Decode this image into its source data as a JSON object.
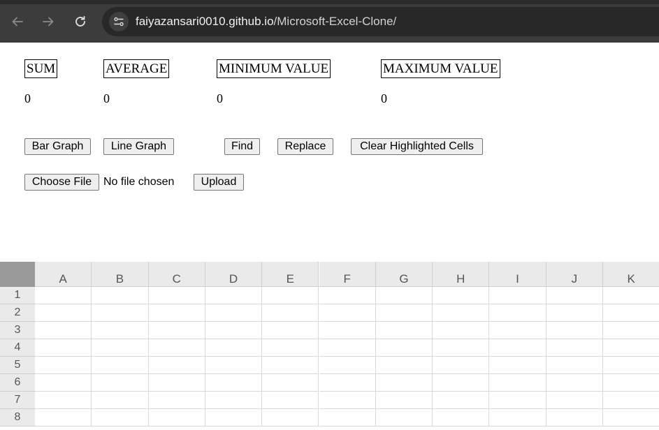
{
  "browser": {
    "url_host": "faiyazansari0010.github.io",
    "url_path": "/Microsoft-Excel-Clone/",
    "icons": [
      "back-arrow-icon",
      "forward-arrow-icon",
      "reload-icon",
      "site-settings-icon"
    ]
  },
  "stats": {
    "sum_label": "SUM",
    "sum_value": "0",
    "average_label": "AVERAGE",
    "average_value": "0",
    "min_label": "MINIMUM VALUE",
    "min_value": "0",
    "max_label": "MAXIMUM VALUE",
    "max_value": "0"
  },
  "toolbar": {
    "bar_graph": "Bar Graph",
    "line_graph": "Line Graph",
    "find": "Find",
    "replace": "Replace",
    "clear_highlighted": "Clear Highlighted Cells"
  },
  "upload": {
    "choose_file": "Choose File",
    "file_status": "No file chosen",
    "upload_button": "Upload"
  },
  "sheet": {
    "columns": [
      "A",
      "B",
      "C",
      "D",
      "E",
      "F",
      "G",
      "H",
      "I",
      "J",
      "K"
    ],
    "rows": [
      "1",
      "2",
      "3",
      "4",
      "5",
      "6",
      "7",
      "8"
    ]
  }
}
